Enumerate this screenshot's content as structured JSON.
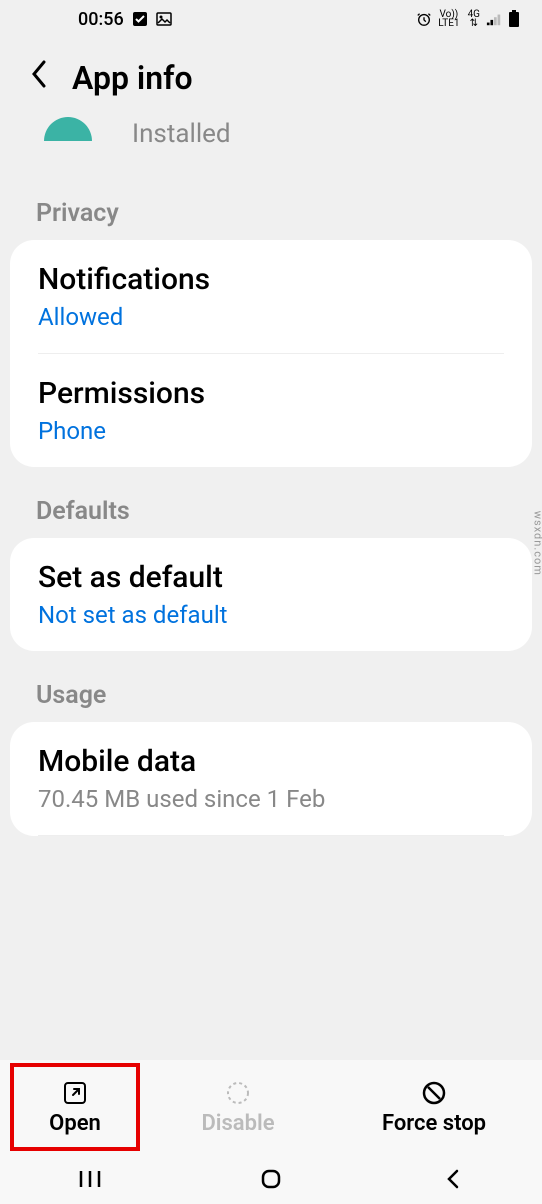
{
  "status": {
    "time": "00:56",
    "network": "4G",
    "lte": "LTE1",
    "vo": "Vo))"
  },
  "header": {
    "title": "App info",
    "installed": "Installed"
  },
  "sections": {
    "privacy": {
      "label": "Privacy",
      "notifications": {
        "title": "Notifications",
        "value": "Allowed"
      },
      "permissions": {
        "title": "Permissions",
        "value": "Phone"
      }
    },
    "defaults": {
      "label": "Defaults",
      "set_default": {
        "title": "Set as default",
        "value": "Not set as default"
      }
    },
    "usage": {
      "label": "Usage",
      "mobile_data": {
        "title": "Mobile data",
        "value": "70.45 MB used since 1 Feb"
      }
    }
  },
  "bottom": {
    "open": "Open",
    "disable": "Disable",
    "force_stop": "Force stop"
  },
  "watermark": "wsxdn.com"
}
